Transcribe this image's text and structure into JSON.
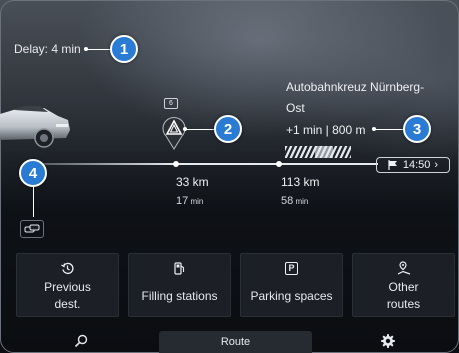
{
  "delay": {
    "text": "Delay: 4 min"
  },
  "callouts": [
    "1",
    "2",
    "3",
    "4"
  ],
  "destination": {
    "name_line1": "Autobahnkreuz Nürnberg-",
    "name_line2": "Ost",
    "meta": "+1 min | 800 m"
  },
  "camera": {
    "label": "6"
  },
  "eta": {
    "time": "14:50"
  },
  "waypoints": [
    {
      "km": "33 km",
      "min_value": "17",
      "min_unit": "min"
    },
    {
      "km": "113 km",
      "min_value": "58",
      "min_unit": "min"
    }
  ],
  "tiles": [
    {
      "icon": "history-icon",
      "label": "Previous\ndest."
    },
    {
      "icon": "fuel-pump-icon",
      "label": "Filling stations"
    },
    {
      "icon": "parking-icon",
      "label": "Parking spaces",
      "icon_text": "P"
    },
    {
      "icon": "alternate-route-icon",
      "label": "Other\nroutes"
    }
  ],
  "bottom_bar": {
    "route_label": "Route"
  },
  "colors": {
    "callout": "#2a7bd4",
    "tile_bg": "#1c2026"
  }
}
